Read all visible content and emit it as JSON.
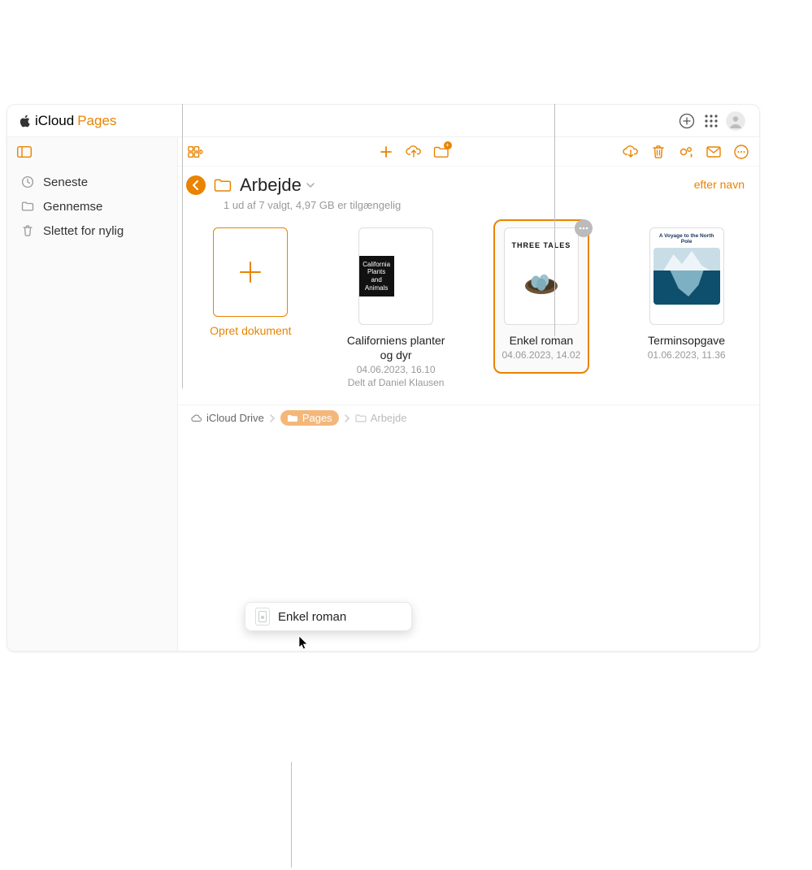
{
  "brand": {
    "icloud": "iCloud",
    "pages": "Pages"
  },
  "sidebar": {
    "items": [
      {
        "label": "Seneste"
      },
      {
        "label": "Gennemse"
      },
      {
        "label": "Slettet for nylig"
      }
    ]
  },
  "folder": {
    "name": "Arbejde",
    "status": "1 ud af 7 valgt, 4,97 GB er tilgængelig"
  },
  "sort": {
    "label": "efter navn"
  },
  "create": {
    "label": "Opret dokument"
  },
  "docs": [
    {
      "title": "Californiens planter og dyr",
      "date": "04.06.2023, 16.10",
      "shared": "Delt af Daniel Klausen",
      "thumb_text": "California Plants and Animals"
    },
    {
      "title": "Enkel roman",
      "date": "04.06.2023, 14.02",
      "thumb_text": "THREE TALES"
    },
    {
      "title": "Terminsopgave",
      "date": "01.06.2023, 11.36",
      "thumb_text": "A Voyage to the North Pole"
    }
  ],
  "breadcrumb": {
    "root": "iCloud Drive",
    "mid": "Pages",
    "leaf": "Arbejde"
  },
  "drag": {
    "label": "Enkel roman"
  },
  "colors": {
    "accent": "#e98300"
  }
}
